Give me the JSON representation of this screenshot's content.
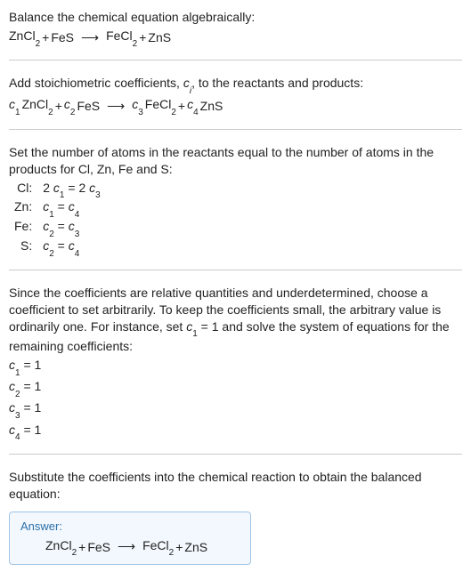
{
  "section1": {
    "title": "Balance the chemical equation algebraically:",
    "eq": {
      "r1": "ZnCl",
      "r1s": "2",
      "plus1": " + ",
      "r2": "FeS",
      "arrow": "⟶",
      "p1": "FeCl",
      "p1s": "2",
      "plus2": " + ",
      "p2": "ZnS"
    }
  },
  "section2": {
    "text_a": "Add stoichiometric coefficients, ",
    "ci_c": "c",
    "ci_i": "i",
    "text_b": ", to the reactants and products:",
    "eq": {
      "c1c": "c",
      "c1n": "1",
      "r1": " ZnCl",
      "r1s": "2",
      "plus1": " + ",
      "c2c": "c",
      "c2n": "2",
      "r2": " FeS",
      "arrow": "⟶",
      "c3c": "c",
      "c3n": "3",
      "p1": " FeCl",
      "p1s": "2",
      "plus2": " + ",
      "c4c": "c",
      "c4n": "4",
      "p2": " ZnS"
    }
  },
  "section3": {
    "text": "Set the number of atoms in the reactants equal to the number of atoms in the products for Cl, Zn, Fe and S:",
    "rows": [
      {
        "el": "Cl:",
        "lhs_a": "2 ",
        "lhs_c": "c",
        "lhs_n": "1",
        "eq": " = 2 ",
        "rhs_c": "c",
        "rhs_n": "3"
      },
      {
        "el": "Zn:",
        "lhs_a": "",
        "lhs_c": "c",
        "lhs_n": "1",
        "eq": " = ",
        "rhs_c": "c",
        "rhs_n": "4"
      },
      {
        "el": "Fe:",
        "lhs_a": "",
        "lhs_c": "c",
        "lhs_n": "2",
        "eq": " = ",
        "rhs_c": "c",
        "rhs_n": "3"
      },
      {
        "el": "S:",
        "lhs_a": "",
        "lhs_c": "c",
        "lhs_n": "2",
        "eq": " = ",
        "rhs_c": "c",
        "rhs_n": "4"
      }
    ]
  },
  "section4": {
    "text_a": "Since the coefficients are relative quantities and underdetermined, choose a coefficient to set arbitrarily. To keep the coefficients small, the arbitrary value is ordinarily one. For instance, set ",
    "c": "c",
    "cn": "1",
    "text_b": " = 1 and solve the system of equations for the remaining coefficients:",
    "assigns": [
      {
        "c": "c",
        "n": "1",
        "v": " = 1"
      },
      {
        "c": "c",
        "n": "2",
        "v": " = 1"
      },
      {
        "c": "c",
        "n": "3",
        "v": " = 1"
      },
      {
        "c": "c",
        "n": "4",
        "v": " = 1"
      }
    ]
  },
  "section5": {
    "text": "Substitute the coefficients into the chemical reaction to obtain the balanced equation:",
    "answer_label": "Answer:",
    "eq": {
      "r1": "ZnCl",
      "r1s": "2",
      "plus1": " + ",
      "r2": "FeS",
      "arrow": "⟶",
      "p1": "FeCl",
      "p1s": "2",
      "plus2": " + ",
      "p2": "ZnS"
    }
  }
}
